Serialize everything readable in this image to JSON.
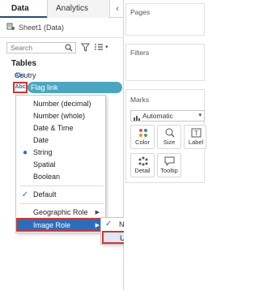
{
  "tabs": {
    "data": "Data",
    "analytics": "Analytics",
    "collapse": "‹"
  },
  "datasource": {
    "name": "Sheet1 (Data)"
  },
  "search": {
    "placeholder": "Search"
  },
  "tables": {
    "heading": "Tables",
    "fields": [
      {
        "type": "Abc",
        "label": "Coutry"
      },
      {
        "type": "Abc",
        "label": "Flag link"
      }
    ]
  },
  "context_menu": {
    "items": [
      {
        "label": "Number (decimal)"
      },
      {
        "label": "Number (whole)"
      },
      {
        "label": "Date & Time"
      },
      {
        "label": "Date"
      },
      {
        "label": "String"
      },
      {
        "label": "Spatial"
      },
      {
        "label": "Boolean"
      },
      {
        "label": "Default"
      },
      {
        "label": "Geographic Role"
      },
      {
        "label": "Image Role"
      }
    ],
    "checked": [
      "String",
      "Default"
    ],
    "highlighted": "Image Role"
  },
  "submenu": {
    "items": [
      {
        "label": "None"
      },
      {
        "label": "URL"
      }
    ],
    "checked": "None"
  },
  "cards": {
    "pages": "Pages",
    "filters": "Filters",
    "marks": "Marks"
  },
  "marks": {
    "type": "Automatic",
    "shelves": [
      {
        "label": "Color",
        "icon": "color-icon"
      },
      {
        "label": "Size",
        "icon": "size-icon"
      },
      {
        "label": "Label",
        "icon": "label-icon"
      },
      {
        "label": "Detail",
        "icon": "detail-icon"
      },
      {
        "label": "Tooltip",
        "icon": "tooltip-icon"
      }
    ]
  },
  "colors": {
    "accent": "#2a6ebb",
    "pill": "#4aa6c2",
    "highlight_outline": "#e0302a",
    "menu_highlight": "#2a6ebb"
  }
}
